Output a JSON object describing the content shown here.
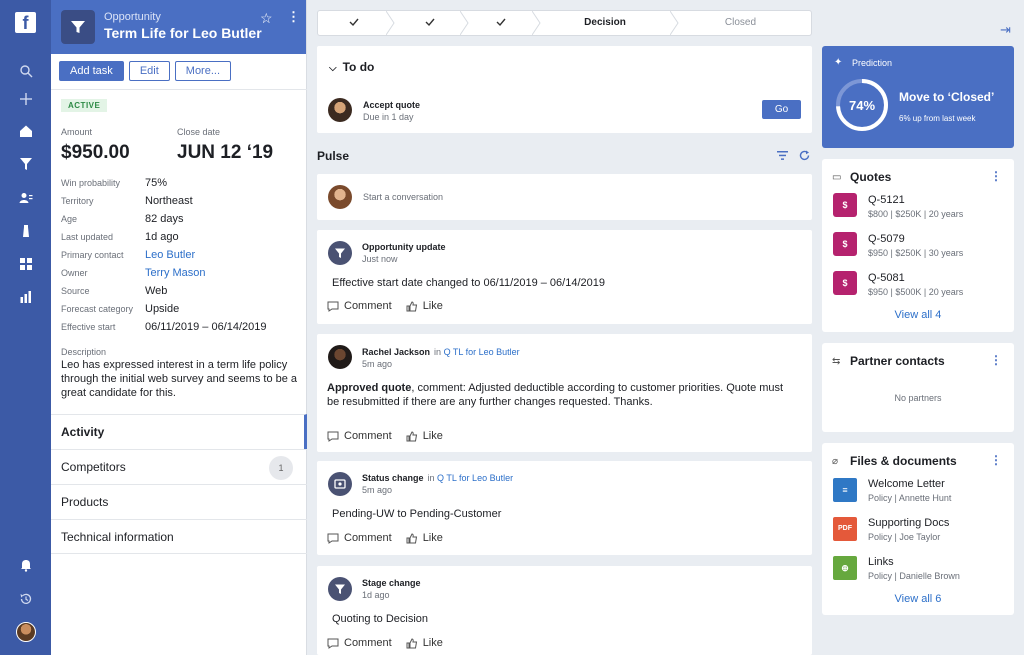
{
  "app": {
    "logo_letter": "f"
  },
  "header": {
    "kicker": "Opportunity",
    "title": "Term Life for Leo Butler",
    "buttons": {
      "add_task": "Add task",
      "edit": "Edit",
      "more": "More..."
    }
  },
  "details": {
    "status": "ACTIVE",
    "amount_label": "Amount",
    "amount": "$950.00",
    "close_label": "Close date",
    "close_date": "JUN 12 ‘19",
    "fields": [
      {
        "k": "Win probability",
        "v": "75%"
      },
      {
        "k": "Territory",
        "v": "Northeast"
      },
      {
        "k": "Age",
        "v": "82 days"
      },
      {
        "k": "Last updated",
        "v": "1d ago"
      },
      {
        "k": "Primary contact",
        "v": "Leo Butler"
      },
      {
        "k": "Owner",
        "v": "Terry Mason"
      },
      {
        "k": "Source",
        "v": "Web"
      },
      {
        "k": "Forecast category",
        "v": "Upside"
      },
      {
        "k": "Effective start",
        "v": "06/11/2019 – 06/14/2019"
      }
    ],
    "description_label": "Description",
    "description": "Leo has expressed interest in a term life policy through the initial web survey and seems to be a great candidate for this."
  },
  "left_nav": [
    {
      "label": "Activity"
    },
    {
      "label": "Competitors",
      "count": "1"
    },
    {
      "label": "Products"
    },
    {
      "label": "Technical information"
    }
  ],
  "stages": [
    "Decision",
    "Closed"
  ],
  "todo": {
    "title": "To do",
    "item_title": "Accept quote",
    "item_sub": "Due in 1 day",
    "go": "Go"
  },
  "pulse": {
    "title": "Pulse",
    "composer_placeholder": "Start a conversation",
    "posts": [
      {
        "title": "Opportunity update",
        "time": "Just now",
        "body": "Effective start date changed to 06/11/2019 – 06/14/2019"
      },
      {
        "title": "Rachel Jackson",
        "in": "in",
        "ctx": "Q TL for Leo Butler",
        "time": "5m ago",
        "body_bold": "Approved quote",
        "body": ", comment: Adjusted deductible according to customer priorities. Quote must be resubmitted if there are any further changes requested. Thanks."
      },
      {
        "title": "Status change",
        "in": "in",
        "ctx": "Q TL for Leo Butler",
        "time": "5m ago",
        "body": "Pending-UW to Pending-Customer"
      },
      {
        "title": "Stage change",
        "time": "1d ago",
        "body": "Quoting to Decision"
      }
    ],
    "comment": "Comment",
    "like": "Like"
  },
  "prediction": {
    "label": "Prediction",
    "percent": "74%",
    "percent_value": 74,
    "headline": "Move to ‘Closed’",
    "sub": "6% up from last week"
  },
  "quotes": {
    "title": "Quotes",
    "items": [
      {
        "id": "Q-5121",
        "detail": "$800 | $250K | 20 years"
      },
      {
        "id": "Q-5079",
        "detail": "$950 | $250K | 30 years"
      },
      {
        "id": "Q-5081",
        "detail": "$950 | $500K | 20 years"
      }
    ],
    "view_all": "View all 4"
  },
  "partners": {
    "title": "Partner contacts",
    "empty": "No partners"
  },
  "files": {
    "title": "Files & documents",
    "items": [
      {
        "name": "Welcome Letter",
        "meta": "Policy | Annette Hunt"
      },
      {
        "name": "Supporting Docs",
        "meta": "Policy | Joe Taylor"
      },
      {
        "name": "Links",
        "meta": "Policy | Danielle Brown"
      }
    ],
    "view_all": "View all 6"
  },
  "colors": {
    "brand": "#4a6fc3",
    "rail": "#3c5aa6",
    "quote": "#b5226e"
  }
}
